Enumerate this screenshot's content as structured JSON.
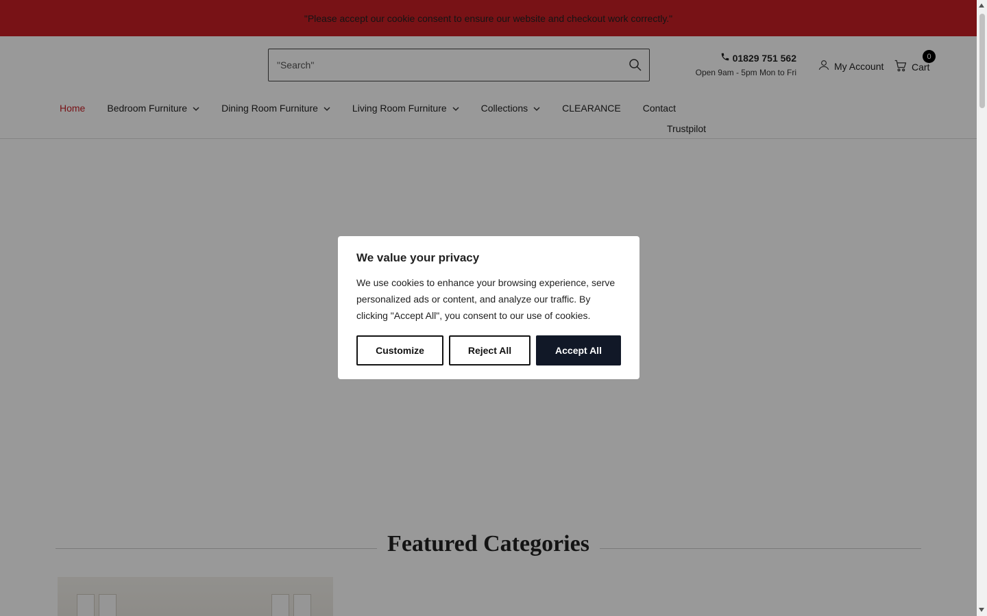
{
  "announcement": {
    "text": "\"Please accept our cookie consent to ensure our website and checkout work correctly.\""
  },
  "header": {
    "search_placeholder": "\"Search\"",
    "phone": "01829 751 562",
    "hours": "Open 9am - 5pm Mon to Fri",
    "account_label": "My Account",
    "cart_label": "Cart",
    "cart_count": "0"
  },
  "nav": {
    "items": [
      {
        "label": "Home",
        "active": true,
        "dropdown": false
      },
      {
        "label": "Bedroom Furniture",
        "dropdown": true
      },
      {
        "label": "Dining Room Furniture",
        "dropdown": true
      },
      {
        "label": "Living Room Furniture",
        "dropdown": true
      },
      {
        "label": "Collections",
        "dropdown": true
      },
      {
        "label": "CLEARANCE",
        "dropdown": false
      },
      {
        "label": "Contact",
        "dropdown": false
      }
    ],
    "second_row": "Trustpilot"
  },
  "main": {
    "featured_title": "Featured Categories"
  },
  "cookie_modal": {
    "title": "We value your privacy",
    "body": "We use cookies to enhance your browsing experience, serve personalized ads or content, and analyze our traffic. By clicking \"Accept All\", you consent to our use of cookies.",
    "customize_label": "Customize",
    "reject_label": "Reject All",
    "accept_label": "Accept All"
  },
  "colors": {
    "brand_red": "#c81e25",
    "accept_button": "#111827"
  },
  "icons": [
    "search-icon",
    "phone-icon",
    "user-icon",
    "cart-icon",
    "chevron-down-icon"
  ]
}
